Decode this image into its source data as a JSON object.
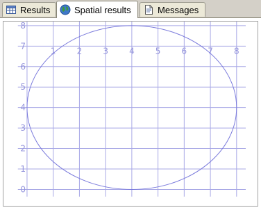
{
  "tabs": [
    {
      "label": "Results",
      "icon": "grid-icon",
      "active": false
    },
    {
      "label": "Spatial results",
      "icon": "globe-icon",
      "active": true
    },
    {
      "label": "Messages",
      "icon": "document-icon",
      "active": false
    }
  ],
  "chart_data": {
    "type": "scatter",
    "x_ticks": [
      1,
      2,
      3,
      4,
      5,
      6,
      7,
      8
    ],
    "y_ticks": [
      0,
      1,
      2,
      3,
      4,
      5,
      6,
      7,
      8
    ],
    "xlim": [
      -0.9,
      8.8
    ],
    "ylim": [
      -0.8,
      8.2
    ],
    "shapes": [
      {
        "kind": "circle",
        "center": [
          4,
          4
        ],
        "radius": 4
      }
    ],
    "grid": true,
    "colors": {
      "grid": "#a8a8e6",
      "shape": "#7b7bdc",
      "ticks": "#9494dc"
    }
  }
}
